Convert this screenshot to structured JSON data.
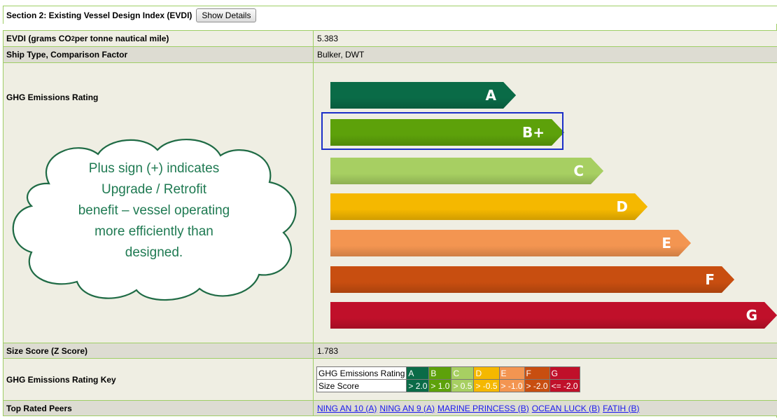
{
  "section": {
    "title": "Section 2: Existing Vessel Design Index (EVDI)",
    "show_details_label": "Show Details"
  },
  "rows": {
    "evdi": {
      "label_pre": "EVDI (grams CO",
      "label_sub": "2",
      "label_post": " per tonne nautical mile)",
      "value": "5.383"
    },
    "ship_type": {
      "label": "Ship Type, Comparison Factor",
      "value": "Bulker, DWT"
    },
    "ghg_rating": {
      "label": "GHG Emissions Rating"
    },
    "size_score": {
      "label": "Size Score (Z Score)",
      "value": "1.783"
    },
    "rating_key": {
      "label": "GHG Emissions Rating Key"
    },
    "peers": {
      "label": "Top Rated Peers"
    }
  },
  "rating_bars": [
    {
      "grade": "A",
      "color": "#0a6b47",
      "selected": false
    },
    {
      "grade": "B+",
      "color": "#5da10a",
      "selected": true
    },
    {
      "grade": "C",
      "color": "#a7cf62",
      "selected": false
    },
    {
      "grade": "D",
      "color": "#f5b800",
      "selected": false
    },
    {
      "grade": "E",
      "color": "#f39551",
      "selected": false
    },
    {
      "grade": "F",
      "color": "#c84e10",
      "selected": false
    },
    {
      "grade": "G",
      "color": "#c0102a",
      "selected": false
    }
  ],
  "callout": {
    "lines": [
      "Plus sign (+) indicates",
      "Upgrade / Retrofit",
      "benefit – vessel operating",
      "more efficiently than",
      "designed."
    ]
  },
  "key_table": {
    "rating_header": "GHG Emissions Rating",
    "score_header": "Size Score",
    "grades": [
      "A",
      "B",
      "C",
      "D",
      "E",
      "F",
      "G"
    ],
    "scores": [
      "> 2.0",
      "> 1.0",
      "> 0.5",
      "> -0.5",
      "> -1.0",
      "> -2.0",
      "<= -2.0"
    ],
    "colors": [
      "#0a6b47",
      "#5da10a",
      "#a7cf62",
      "#f5b800",
      "#f39551",
      "#c84e10",
      "#c0102a"
    ]
  },
  "peers": [
    "NING AN 10 (A)",
    "NING AN 9 (A)",
    "MARINE PRINCESS (B)",
    "OCEAN LUCK (B)",
    "FATIH (B)"
  ]
}
